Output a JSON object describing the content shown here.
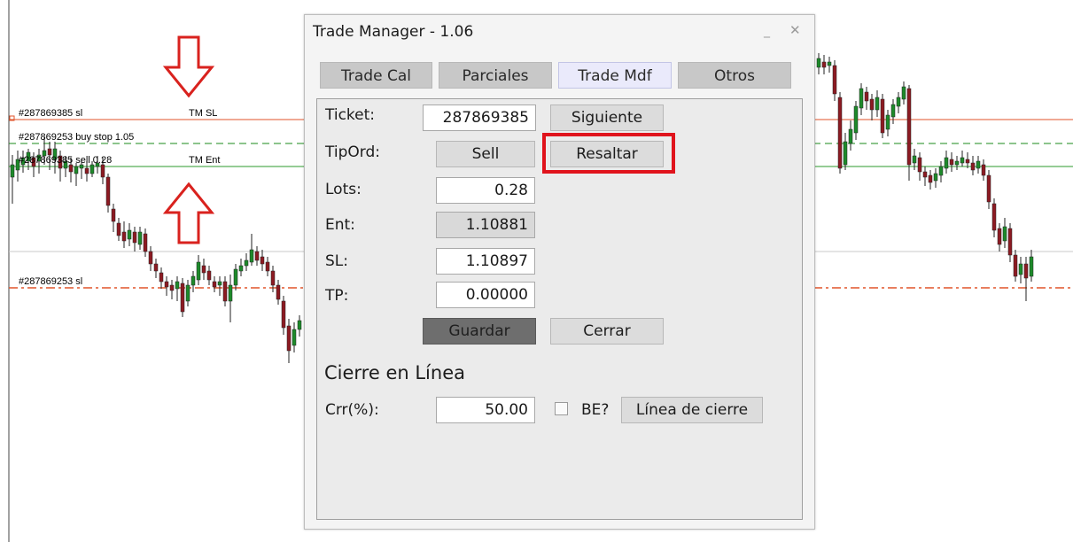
{
  "chart": {
    "labels": {
      "sl_line": "#287869385 sl",
      "tm_sl": "TM SL",
      "buy_stop_line": "#287869253 buy stop 1.05",
      "sell_line": "#287869385 sell 0.28",
      "tm_ent": "TM Ent",
      "sl_line_2": "#287869253 sl"
    },
    "colors": {
      "sl_line": "#e0532a",
      "buy_stop_line": "#1a8a1a",
      "entry_line": "#2b9a2b",
      "candle_up": "#1d8a2a",
      "candle_down": "#8c1a22",
      "arrow": "#d9221e"
    }
  },
  "dialog": {
    "title": "Trade Manager - 1.06",
    "minimize_glyph": "_",
    "close_glyph": "✕",
    "tabs": [
      {
        "label": "Trade Cal",
        "active": false
      },
      {
        "label": "Parciales",
        "active": false
      },
      {
        "label": "Trade Mdf",
        "active": true
      },
      {
        "label": "Otros",
        "active": false
      }
    ],
    "ticket": {
      "label": "Ticket:",
      "value": "287869385",
      "next_button": "Siguiente"
    },
    "tipord": {
      "label": "TipOrd:",
      "value": "Sell",
      "highlight_button": "Resaltar"
    },
    "lots": {
      "label": "Lots:",
      "value": "0.28"
    },
    "ent": {
      "label": "Ent:",
      "value": "1.10881"
    },
    "sl": {
      "label": "SL:",
      "value": "1.10897"
    },
    "tp": {
      "label": "TP:",
      "value": "0.00000"
    },
    "save_button": "Guardar",
    "close_button": "Cerrar",
    "section_title": "Cierre en Línea",
    "crr": {
      "label": "Crr(%):",
      "value": "50.00"
    },
    "be_label": "BE?",
    "be_checked": false,
    "close_line_button": "Línea de cierre",
    "highlight_color": "#e0131c"
  }
}
